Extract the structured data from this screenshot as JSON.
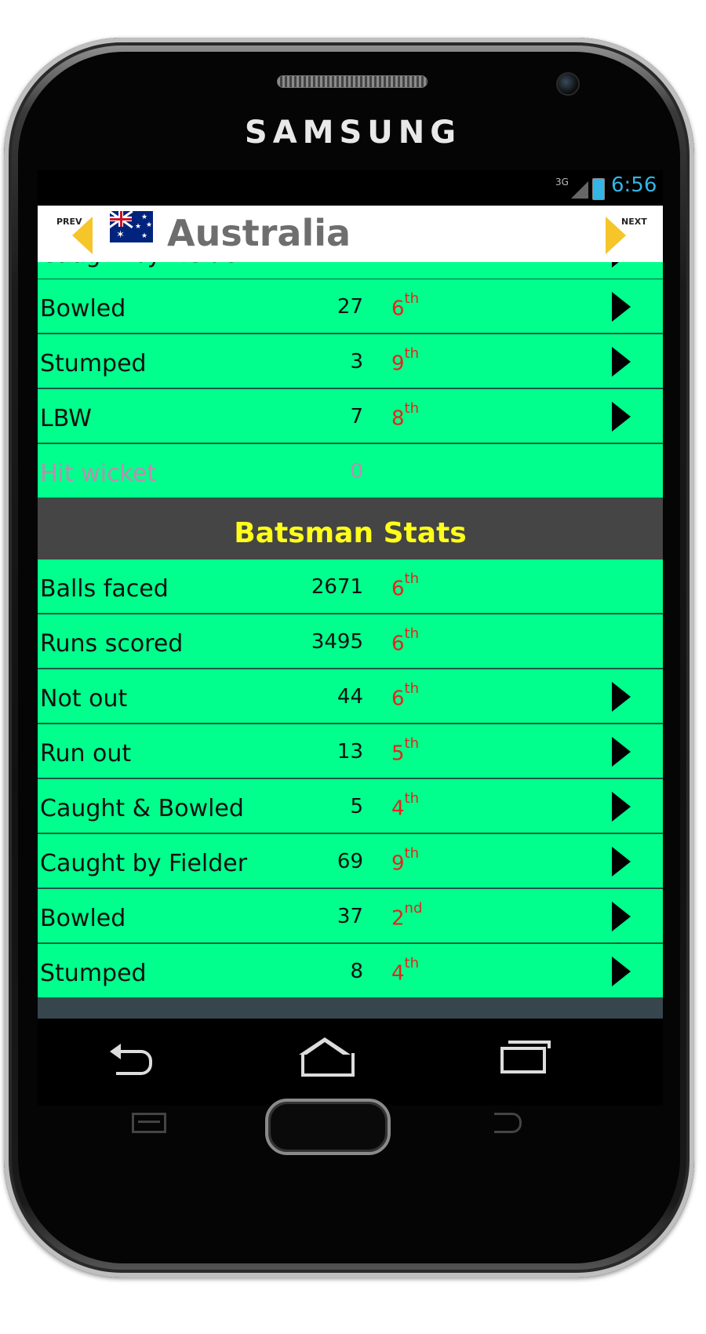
{
  "device": {
    "brand": "SAMSUNG"
  },
  "status_bar": {
    "network": "3G",
    "time": "6:56",
    "time_color": "#33b5e5"
  },
  "header": {
    "prev_label": "PREV",
    "next_label": "NEXT",
    "country": "Australia",
    "arrow_color": "#f5c52a"
  },
  "partial_top_row": {
    "label": "Caught by Fielder"
  },
  "bowler_rows": [
    {
      "label": "Bowled",
      "value": "27",
      "rank": "6",
      "suffix": "th",
      "arrow": true
    },
    {
      "label": "Stumped",
      "value": "3",
      "rank": "9",
      "suffix": "th",
      "arrow": true
    },
    {
      "label": "LBW",
      "value": "7",
      "rank": "8",
      "suffix": "th",
      "arrow": true
    },
    {
      "label": "Hit wicket",
      "value": "0",
      "rank": "",
      "suffix": "",
      "arrow": false,
      "disabled": true
    }
  ],
  "section": {
    "title": "Batsman Stats",
    "title_color": "#ffff1a"
  },
  "batsman_rows": [
    {
      "label": "Balls faced",
      "value": "2671",
      "rank": "6",
      "suffix": "th",
      "arrow": false
    },
    {
      "label": "Runs scored",
      "value": "3495",
      "rank": "6",
      "suffix": "th",
      "arrow": false
    },
    {
      "label": "Not out",
      "value": "44",
      "rank": "6",
      "suffix": "th",
      "arrow": true
    },
    {
      "label": "Run out",
      "value": "13",
      "rank": "5",
      "suffix": "th",
      "arrow": true
    },
    {
      "label": "Caught & Bowled",
      "value": "5",
      "rank": "4",
      "suffix": "th",
      "arrow": true
    },
    {
      "label": "Caught by Fielder",
      "value": "69",
      "rank": "9",
      "suffix": "th",
      "arrow": true
    },
    {
      "label": "Bowled",
      "value": "37",
      "rank": "2",
      "suffix": "nd",
      "arrow": true
    },
    {
      "label": "Stumped",
      "value": "8",
      "rank": "4",
      "suffix": "th",
      "arrow": true
    }
  ],
  "colors": {
    "row_bg": "#00ff8c",
    "rank": "#e8231d",
    "section_bg": "#454545"
  },
  "icons": {
    "prev": "prev-arrow-icon",
    "next": "next-arrow-icon",
    "flag": "australia-flag-icon",
    "row_arrow": "play-arrow-icon",
    "nav_back": "back-icon",
    "nav_home": "home-icon",
    "nav_recent": "recent-apps-icon"
  }
}
